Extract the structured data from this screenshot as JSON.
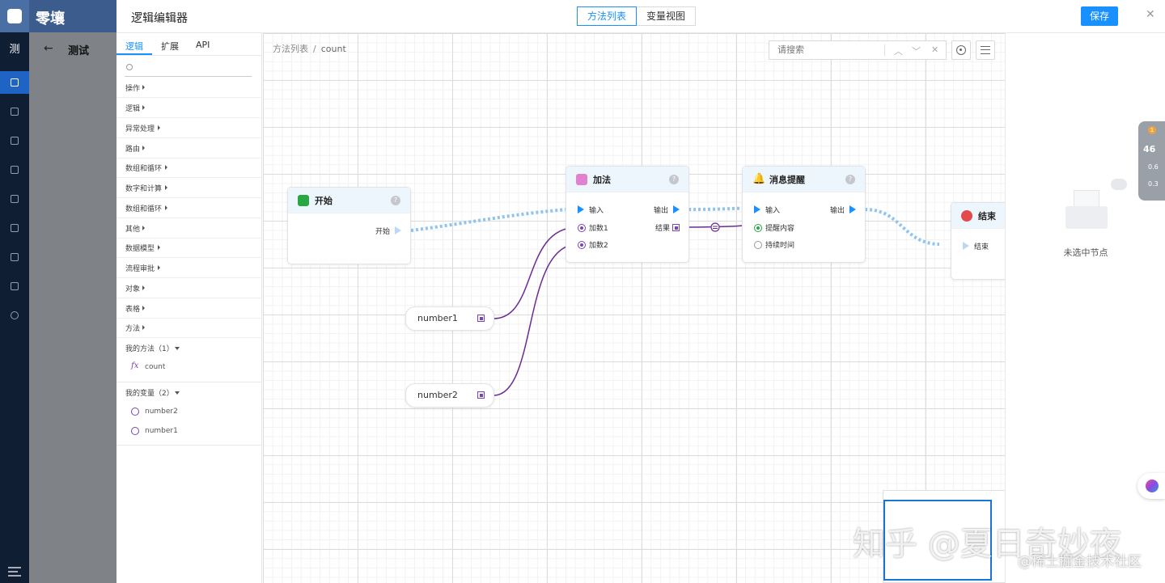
{
  "app": {
    "brand": "零壤",
    "project_char": "测",
    "side_title": "测试"
  },
  "header": {
    "title": "逻辑编辑器",
    "view_tabs": [
      {
        "label": "方法列表",
        "active": true
      },
      {
        "label": "变量视图",
        "active": false
      }
    ],
    "save_label": "保存",
    "close": "✕"
  },
  "left_panel": {
    "tabs": [
      {
        "label": "逻辑",
        "active": true
      },
      {
        "label": "扩展"
      },
      {
        "label": "API"
      }
    ],
    "search_placeholder": "",
    "categories": [
      "操作",
      "逻辑",
      "异常处理",
      "路由",
      "数组和循环",
      "数字和计算",
      "数组和循环",
      "其他",
      "数据模型",
      "流程审批",
      "对象",
      "表格",
      "方法"
    ],
    "my_methods": {
      "label": "我的方法",
      "count": "（1）",
      "items": [
        {
          "icon": "fx",
          "label": "count"
        }
      ]
    },
    "my_vars": {
      "label": "我的变量",
      "count": "（2）",
      "items": [
        {
          "label": "number2"
        },
        {
          "label": "number1"
        }
      ]
    }
  },
  "canvas": {
    "breadcrumb": [
      "方法列表",
      "count"
    ],
    "search_placeholder": "请搜索",
    "nodes": {
      "start": {
        "title": "开始",
        "out_label": "开始"
      },
      "add": {
        "title": "加法",
        "in_label": "输入",
        "out_label": "输出",
        "param1": "加数1",
        "param2": "加数2",
        "result": "结果"
      },
      "notify": {
        "title": "消息提醒",
        "in_label": "输入",
        "out_label": "输出",
        "param1": "提醒内容",
        "param2": "持续时间"
      },
      "end": {
        "title": "结束",
        "in_label": "结束"
      },
      "var1": {
        "label": "number1"
      },
      "var2": {
        "label": "number2"
      }
    }
  },
  "right_panel": {
    "empty_text": "未选中节点"
  },
  "monitor": {
    "badge": "1",
    "value": "46",
    "stat1": "0.6",
    "stat2": "0.3"
  },
  "watermark": {
    "line1": "知乎 @夏日奇妙夜",
    "line2": "@稀土掘金技术社区"
  },
  "colors": {
    "primary": "#1890ff",
    "purple": "#7a44b3",
    "green": "#27a844",
    "red": "#e24b4b",
    "nav": "#0f1e33"
  }
}
